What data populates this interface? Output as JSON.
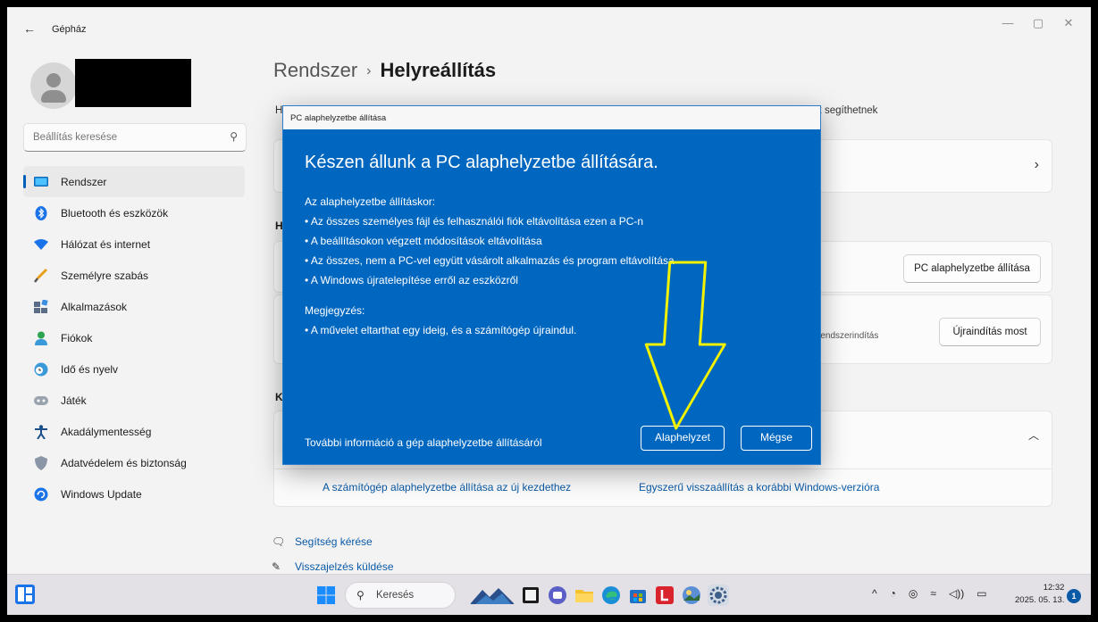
{
  "window": {
    "title": "Gépház",
    "back_icon": "back-arrow-icon",
    "controls": [
      "minimize-icon",
      "maximize-icon",
      "close-icon"
    ]
  },
  "user": {
    "avatar_icon": "user-avatar-icon"
  },
  "sidebar": {
    "search": {
      "placeholder": "Beállítás keresése",
      "icon": "search-icon"
    },
    "items": [
      {
        "label": "Rendszer",
        "icon": "system-display-icon",
        "active": true
      },
      {
        "label": "Bluetooth és eszközök",
        "icon": "bluetooth-icon"
      },
      {
        "label": "Hálózat és internet",
        "icon": "wifi-network-icon"
      },
      {
        "label": "Személyre szabás",
        "icon": "paintbrush-icon"
      },
      {
        "label": "Alkalmazások",
        "icon": "apps-icon"
      },
      {
        "label": "Fiókok",
        "icon": "account-icon"
      },
      {
        "label": "Idő és nyelv",
        "icon": "globe-clock-icon"
      },
      {
        "label": "Játék",
        "icon": "gamepad-icon"
      },
      {
        "label": "Akadálymentesség",
        "icon": "accessibility-icon"
      },
      {
        "label": "Adatvédelem és biztonság",
        "icon": "shield-icon"
      },
      {
        "label": "Windows Update",
        "icon": "windows-update-icon"
      }
    ]
  },
  "main": {
    "breadcrumb": {
      "parent": "Rendszer",
      "separator": "›",
      "current": "Helyreállítás"
    },
    "description_start": "H",
    "description_end": "k segíthetnek",
    "section1_heading_partial": "H",
    "section2_heading_partial": "K",
    "reset_button": "PC alaphelyzetbe állítása",
    "restart_description_partial": "rendszerindítás",
    "restart_button": "Újraindítás most",
    "links": {
      "fresh_start": "A számítógép alaphelyzetbe állítása az új kezdethez",
      "rollback": "Egyszerű visszaállítás a korábbi Windows-verzióra"
    },
    "help": {
      "get_help": "Segítség kérése",
      "feedback": "Visszajelzés küldése"
    }
  },
  "dialog": {
    "title": "PC alaphelyzetbe állítása",
    "heading": "Készen állunk a PC alaphelyzetbe állítására.",
    "intro": "Az alaphelyzetbe állításkor:",
    "bullets": [
      "• Az összes személyes fájl és felhasználói fiók eltávolítása ezen a PC-n",
      "• A beállításokon végzett módosítások eltávolítása",
      "• Az összes, nem a PC-vel együtt vásárolt alkalmazás és program eltávolítása",
      "• A Windows újratelepítése erről az eszközről"
    ],
    "note_heading": "Megjegyzés:",
    "note_bullets": [
      "• A művelet eltarthat egy ideig, és a számítógép újraindul."
    ],
    "info_link": "További információ a gép alaphelyzetbe állításáról",
    "confirm_button": "Alaphelyzet",
    "cancel_button": "Mégse"
  },
  "annotation": {
    "color": "#f2f200",
    "icon": "yellow-down-arrow-annotation"
  },
  "taskbar": {
    "search_label": "Keresés",
    "time": "12:32",
    "date": "2025. 05. 13.",
    "notification_count": "1",
    "apps": [
      "landscape-wallpaper-icon",
      "task-view-icon",
      "teams-chat-icon",
      "file-explorer-icon",
      "edge-browser-icon",
      "microsoft-store-icon",
      "red-l-app-icon",
      "photos-app-icon",
      "settings-gear-icon"
    ]
  },
  "colors": {
    "accent": "#005fb8",
    "dialog_bg": "#0067c0",
    "link": "#0a5aa6"
  }
}
